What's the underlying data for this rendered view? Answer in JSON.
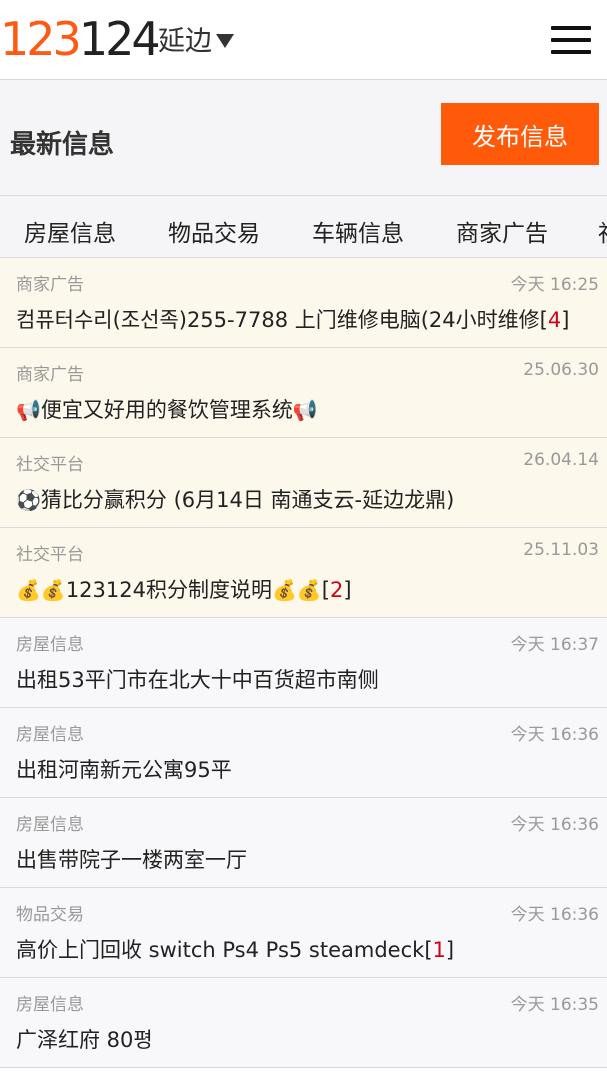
{
  "header": {
    "logo_a": "123",
    "logo_b": "124",
    "city": "延边"
  },
  "titlebar": {
    "title": "最新信息",
    "publish_label": "发布信息"
  },
  "tabs": [
    "房屋信息",
    "物品交易",
    "车辆信息",
    "商家广告",
    "社"
  ],
  "items": [
    {
      "category": "商家广告",
      "time": "今天 16:25",
      "pre": "",
      "title": "컴퓨터수리(조선족)255-7788  上门维修电脑(24小时维修",
      "post": "",
      "count": "4",
      "pinned": true
    },
    {
      "category": "商家广告",
      "time": "25.06.30",
      "pre": "📢",
      "title": "便宜又好用的餐饮管理系统",
      "post": "📢",
      "count": "",
      "pinned": true
    },
    {
      "category": "社交平台",
      "time": "26.04.14",
      "pre": "⚽",
      "title": "猜比分赢积分 (6月14日 南通支云-延边龙鼎)",
      "post": "",
      "count": "",
      "pinned": true
    },
    {
      "category": "社交平台",
      "time": "25.11.03",
      "pre": "💰💰",
      "title": "123124积分制度说明",
      "post": "💰💰",
      "count": "2",
      "pinned": true
    },
    {
      "category": "房屋信息",
      "time": "今天 16:37",
      "pre": "",
      "title": "出租53平门市在北大十中百货超市南侧",
      "post": "",
      "count": "",
      "pinned": false
    },
    {
      "category": "房屋信息",
      "time": "今天 16:36",
      "pre": "",
      "title": "出租河南新元公寓95平",
      "post": "",
      "count": "",
      "pinned": false
    },
    {
      "category": "房屋信息",
      "time": "今天 16:36",
      "pre": "",
      "title": "出售带院子一楼两室一厅",
      "post": "",
      "count": "",
      "pinned": false
    },
    {
      "category": "物品交易",
      "time": "今天 16:36",
      "pre": "",
      "title": "高价上门回收 switch Ps4 Ps5 steamdeck",
      "post": "",
      "count": "1",
      "pinned": false
    },
    {
      "category": "房屋信息",
      "time": "今天 16:35",
      "pre": "",
      "title": "广泽红府  80평",
      "post": "",
      "count": "",
      "pinned": false
    }
  ]
}
